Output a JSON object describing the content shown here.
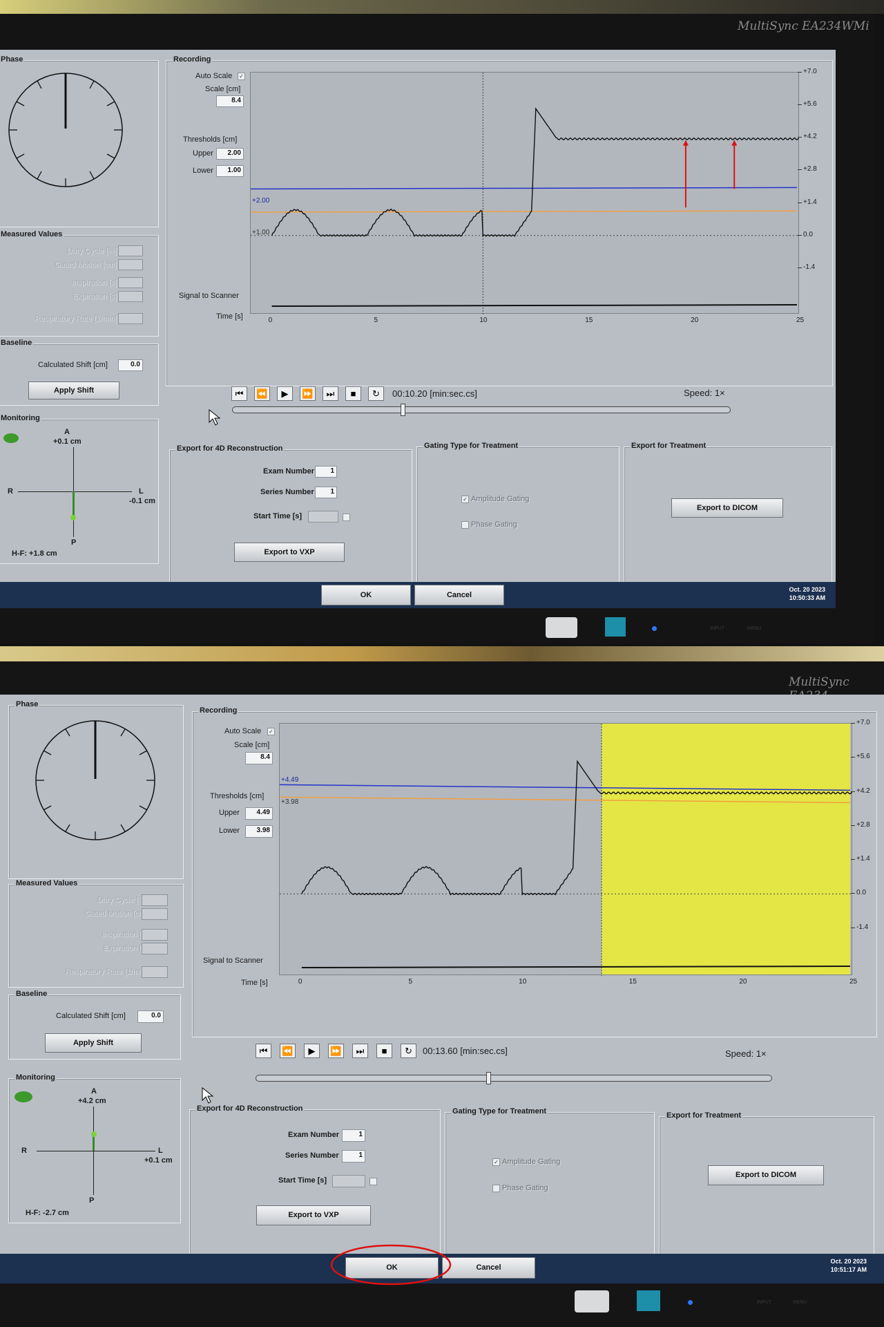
{
  "shared": {
    "phase_title": "Phase",
    "recording_title": "Recording",
    "auto_scale": "Auto Scale",
    "scale_label": "Scale [cm]",
    "thresholds_label": "Thresholds [cm]",
    "upper_label": "Upper",
    "lower_label": "Lower",
    "measured_title": "Measured Values",
    "duty_cycle": "Duty Cycle [%]",
    "gated_motion": "Gated Motion [cm]",
    "inspiration": "Inspiration [s]",
    "expiration": "Expiration [s]",
    "resp_rate": "Respiratory Rate [1/min]",
    "baseline_title": "Baseline",
    "calc_shift": "Calculated Shift [cm]",
    "apply_shift": "Apply Shift",
    "monitoring_title": "Monitoring",
    "axis_a": "A",
    "axis_p": "P",
    "axis_r": "R",
    "axis_l": "L",
    "signal_to_scanner": "Signal to Scanner",
    "time_label": "Time [s]",
    "time_unit": "[min:sec.cs]",
    "speed": "Speed: 1×",
    "export4d_title": "Export for 4D Reconstruction",
    "exam_number": "Exam Number",
    "series_number": "Series Number",
    "start_time": "Start Time [s]",
    "export_vxp": "Export to VXP",
    "gating_title": "Gating Type for Treatment",
    "amplitude_gating": "Amplitude Gating",
    "phase_gating": "Phase Gating",
    "export_treat_title": "Export for Treatment",
    "export_dicom": "Export to DICOM",
    "ok": "OK",
    "cancel": "Cancel",
    "brand_top": "MultiSync EA234WMi",
    "brand_bottom": "MultiSync EA234",
    "date": "Oct. 20 2023",
    "monitor_keys": [
      "INPUT",
      "MENU"
    ],
    "y_ticks": [
      "+7.0",
      "+5.6",
      "+4.2",
      "+2.8",
      "+1.4",
      "0.0",
      "-1.4"
    ],
    "x_ticks": [
      "0",
      "5",
      "10",
      "15",
      "20",
      "25"
    ]
  },
  "screen1": {
    "scale_value": "8.4",
    "upper_value": "2.00",
    "lower_value": "1.00",
    "upper_line_label": "+2.00",
    "lower_line_label": "+1.00",
    "calc_shift_value": "0.0",
    "monitor_ap": "+0.1 cm",
    "monitor_lr": "-0.1 cm",
    "monitor_hf": "H-F: +1.8 cm",
    "playback_time": "00:10.20",
    "exam_value": "1",
    "series_value": "1",
    "time": "10:50:33 AM",
    "slider_position": 0.34,
    "cursor_time_s": 10,
    "annotation_arrows": 2
  },
  "screen2": {
    "scale_value": "8.4",
    "upper_value": "4.49",
    "lower_value": "3.98",
    "upper_line_label": "+4.49",
    "lower_line_label": "+3.98",
    "calc_shift_value": "0.0",
    "monitor_ap": "+4.2 cm",
    "monitor_lr": "+0.1 cm",
    "monitor_hf": "H-F: -2.7 cm",
    "playback_time": "00:13.60",
    "exam_value": "1",
    "series_value": "1",
    "time": "10:51:17 AM",
    "slider_position": 0.45,
    "cursor_time_s": 13.6,
    "highlight": "OK button circled in red"
  },
  "colors": {
    "upper_threshold": "#2233cc",
    "lower_threshold": "#f0a040",
    "gating_window": "#e4e646",
    "annotation": "#dd1111",
    "trace": "#111111"
  }
}
